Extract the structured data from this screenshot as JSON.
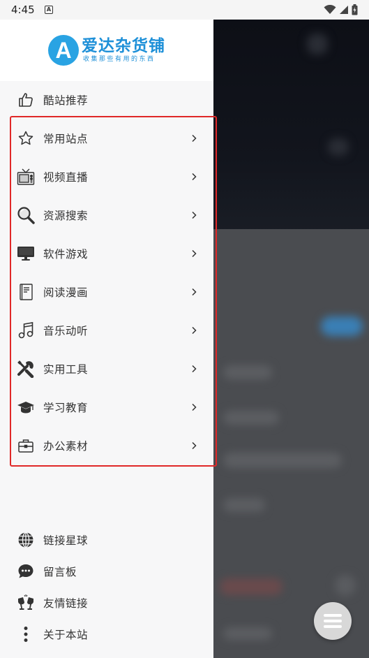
{
  "status_bar": {
    "time": "4:45",
    "sim_label": "A"
  },
  "drawer": {
    "logo": {
      "letter": "A",
      "name": "爱达杂货铺",
      "slogan": "收集那些有用的东西"
    },
    "top_item": {
      "label": "酷站推荐",
      "icon": "thumbs-up-icon"
    },
    "category_items": [
      {
        "label": "常用站点",
        "icon": "star-icon"
      },
      {
        "label": "视频直播",
        "icon": "tv-icon"
      },
      {
        "label": "资源搜索",
        "icon": "search-icon"
      },
      {
        "label": "软件游戏",
        "icon": "monitor-icon"
      },
      {
        "label": "阅读漫画",
        "icon": "book-icon"
      },
      {
        "label": "音乐动听",
        "icon": "music-note-icon"
      },
      {
        "label": "实用工具",
        "icon": "tools-icon"
      },
      {
        "label": "学习教育",
        "icon": "graduation-cap-icon"
      },
      {
        "label": "办公素材",
        "icon": "briefcase-icon"
      }
    ],
    "bottom_items": [
      {
        "label": "链接星球",
        "icon": "globe-icon"
      },
      {
        "label": "留言板",
        "icon": "chat-bubble-icon"
      },
      {
        "label": "友情链接",
        "icon": "cheers-icon"
      },
      {
        "label": "关于本站",
        "icon": "more-vertical-icon"
      }
    ]
  },
  "colors": {
    "brand": "#1e90d8",
    "highlight_box": "#e02828",
    "drawer_bg": "#f7f7f8"
  }
}
